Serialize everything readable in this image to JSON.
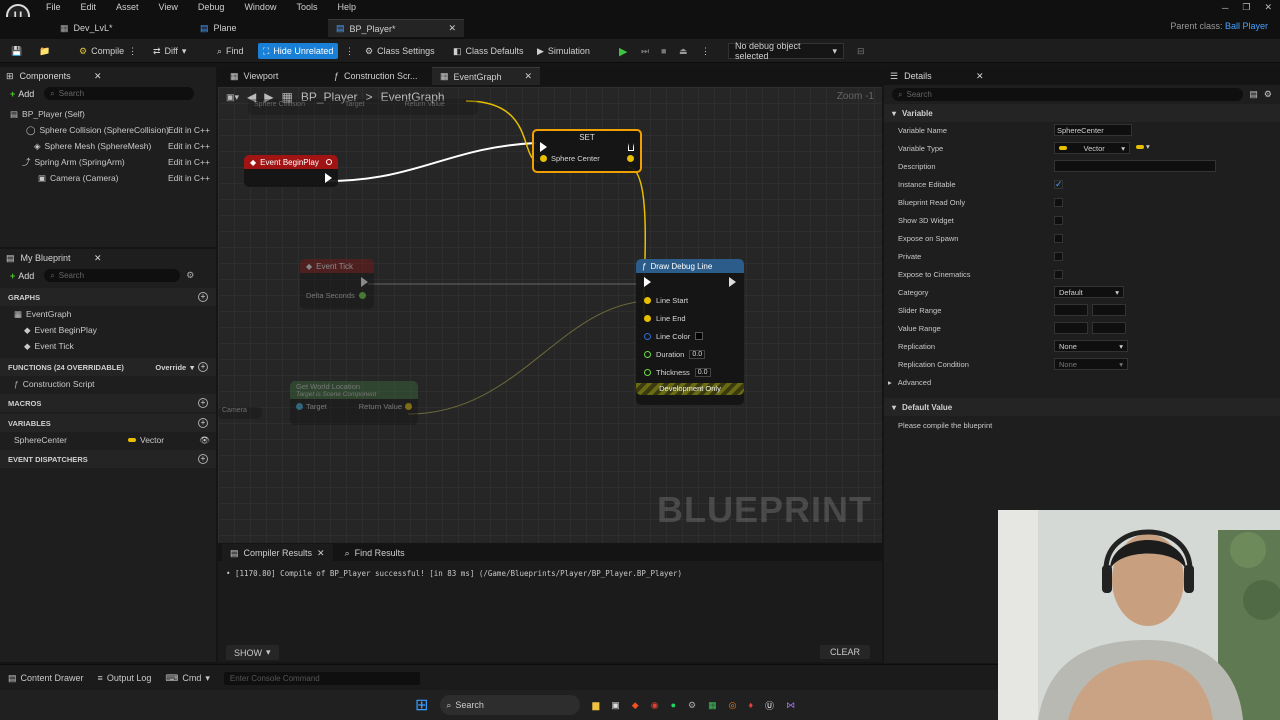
{
  "menu": {
    "file": "File",
    "edit": "Edit",
    "asset": "Asset",
    "view": "View",
    "debug": "Debug",
    "window": "Window",
    "tools": "Tools",
    "help": "Help"
  },
  "tabs": {
    "dev": "Dev_LvL*",
    "plane": "Plane",
    "player": "BP_Player*"
  },
  "parent": {
    "label": "Parent class:",
    "value": "Ball Player"
  },
  "toolbar": {
    "compile": "Compile",
    "diff": "Diff",
    "find": "Find",
    "hide_unrelated": "Hide Unrelated",
    "class_settings": "Class Settings",
    "class_defaults": "Class Defaults",
    "simulation": "Simulation",
    "debug_object": "No debug object selected"
  },
  "components": {
    "title": "Components",
    "add": "Add",
    "search_placeholder": "Search",
    "items": [
      {
        "label": "BP_Player (Self)",
        "edit": ""
      },
      {
        "label": "Sphere Collision (SphereCollision)",
        "edit": "Edit in C++"
      },
      {
        "label": "Sphere Mesh (SphereMesh)",
        "edit": "Edit in C++"
      },
      {
        "label": "Spring Arm (SpringArm)",
        "edit": "Edit in C++"
      },
      {
        "label": "Camera (Camera)",
        "edit": "Edit in C++"
      }
    ]
  },
  "my_blueprint": {
    "title": "My Blueprint",
    "add": "Add",
    "search_placeholder": "Search",
    "graphs": "GRAPHS",
    "eventgraph": "EventGraph",
    "begin_play": "Event BeginPlay",
    "tick": "Event Tick",
    "functions": "FUNCTIONS",
    "functions_count": "(24 OVERRIDABLE)",
    "override": "Override",
    "construction": "Construction Script",
    "macros": "MACROS",
    "variables": "VARIABLES",
    "var_name": "SphereCenter",
    "var_type": "Vector",
    "dispatchers": "EVENT DISPATCHERS"
  },
  "graph_tabs": {
    "viewport": "Viewport",
    "construction": "Construction Scr...",
    "eventgraph": "EventGraph"
  },
  "graph": {
    "breadcrumb_root": "BP_Player",
    "breadcrumb_sep": ">",
    "breadcrumb_leaf": "EventGraph",
    "zoom": "Zoom -1",
    "watermark": "BLUEPRINT",
    "top_node": {
      "left": "Sphere Collision",
      "target": "Target",
      "return": "Return Value"
    },
    "set_node": {
      "title": "SET",
      "pin": "Sphere Center"
    },
    "begin_node": {
      "title": "Event BeginPlay"
    },
    "tick_node": {
      "title": "Event Tick",
      "pin": "Delta Seconds"
    },
    "draw_node": {
      "title": "Draw Debug Line",
      "line_start": "Line Start",
      "line_end": "Line End",
      "line_color": "Line Color",
      "duration": "Duration",
      "duration_val": "0.0",
      "thickness": "Thickness",
      "thickness_val": "0.0",
      "footer": "Development Only"
    },
    "loc_node": {
      "title": "Get World Location",
      "subtitle": "Target is Scene Component",
      "target": "Target",
      "return": "Return Value",
      "camera": "Camera"
    }
  },
  "compiler": {
    "tab": "Compiler Results",
    "find": "Find Results",
    "message": "[1170.80] Compile of BP_Player successful! [in 83 ms] (/Game/Blueprints/Player/BP_Player.BP_Player)",
    "show": "SHOW",
    "clear": "CLEAR"
  },
  "details": {
    "title": "Details",
    "search_placeholder": "Search",
    "section_variable": "Variable",
    "variable_name_label": "Variable Name",
    "variable_name": "SphereCenter",
    "variable_type_label": "Variable Type",
    "variable_type": "Vector",
    "description": "Description",
    "instance_editable": "Instance Editable",
    "bp_readonly": "Blueprint Read Only",
    "show3d": "Show 3D Widget",
    "expose_spawn": "Expose on Spawn",
    "private": "Private",
    "expose_cine": "Expose to Cinematics",
    "category": "Category",
    "category_val": "Default",
    "slider": "Slider Range",
    "value_range": "Value Range",
    "replication": "Replication",
    "replication_val": "None",
    "rep_cond": "Replication Condition",
    "rep_cond_val": "None",
    "advanced": "Advanced",
    "default_value": "Default Value",
    "compile_msg": "Please compile the blueprint"
  },
  "status": {
    "content_drawer": "Content Drawer",
    "output_log": "Output Log",
    "cmd": "Cmd",
    "console_placeholder": "Enter Console Command"
  },
  "taskbar": {
    "search": "Search"
  }
}
